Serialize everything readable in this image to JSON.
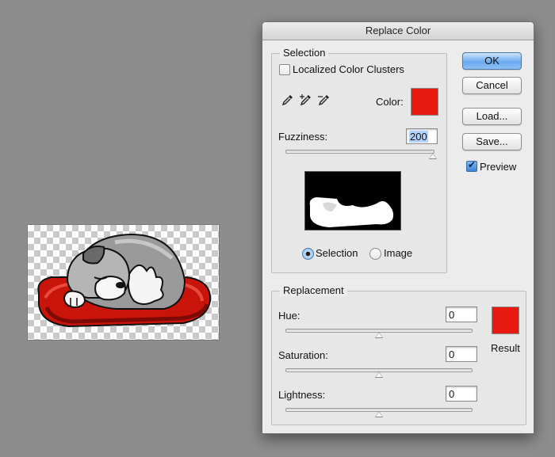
{
  "dialog": {
    "title": "Replace Color",
    "selection": {
      "group_label": "Selection",
      "localized_clusters": {
        "label": "Localized Color Clusters",
        "checked": false
      },
      "color_label": "Color:",
      "color_value": "#e8190e",
      "fuzziness_label": "Fuzziness:",
      "fuzziness_value": "200",
      "fuzziness_fraction": 1.0,
      "view_options": [
        {
          "label": "Selection",
          "selected": true
        },
        {
          "label": "Image",
          "selected": false
        }
      ]
    },
    "replacement": {
      "group_label": "Replacement",
      "hue_label": "Hue:",
      "hue_value": "0",
      "saturation_label": "Saturation:",
      "saturation_value": "0",
      "lightness_label": "Lightness:",
      "lightness_value": "0",
      "result_label": "Result",
      "result_color": "#e8190e"
    },
    "buttons": {
      "ok": "OK",
      "cancel": "Cancel",
      "load": "Load...",
      "save": "Save..."
    },
    "preview": {
      "label": "Preview",
      "checked": true
    }
  },
  "colors": {
    "background": "#8d8d8d",
    "accent_red": "#e8190e",
    "default_button": "#6aaaf0"
  },
  "icons": [
    "eyedropper-icon",
    "eyedropper-plus-icon",
    "eyedropper-minus-icon"
  ]
}
